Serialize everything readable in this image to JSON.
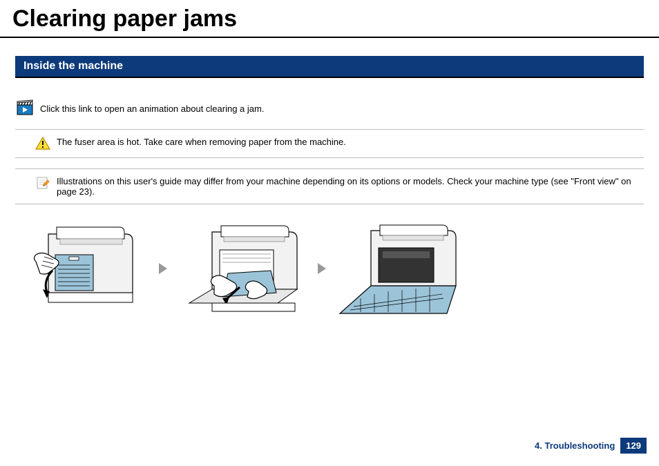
{
  "title": "Clearing paper jams",
  "section_heading": "Inside the machine",
  "animation_link_text": "Click this link to open an animation about clearing a jam.",
  "warning_text": "The fuser area is hot. Take care when removing paper from the machine.",
  "note_text": "Illustrations on this user's guide may differ from your machine depending on its options or models. Check your machine type (see \"Front view\" on page 23).",
  "footer": {
    "chapter": "4. Troubleshooting",
    "page": "129"
  },
  "icons": {
    "animation": "clapper-play-icon",
    "warning": "warning-triangle-icon",
    "note": "note-pencil-icon"
  },
  "illustration_steps": [
    "step-1-open-rear-cover",
    "step-2-pull-paper-out",
    "step-3-lower-tray"
  ]
}
